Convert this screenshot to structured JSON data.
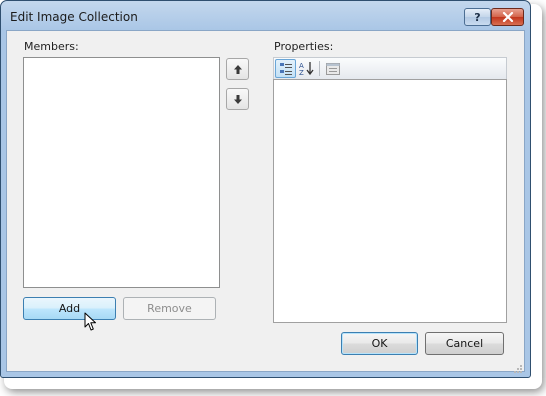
{
  "window": {
    "title": "Edit Image Collection",
    "help_label": "?",
    "close_icon": "close-icon"
  },
  "members": {
    "label": "Members:",
    "items": [],
    "move_up_icon": "arrow-up-icon",
    "move_down_icon": "arrow-down-icon",
    "add_label": "Add",
    "remove_label": "Remove"
  },
  "properties": {
    "label": "Properties:",
    "toolbar": {
      "categorized_icon": "categorized-view-icon",
      "alphabetical_icon": "alphabetical-sort-icon",
      "property_pages_icon": "property-pages-icon"
    }
  },
  "footer": {
    "ok_label": "OK",
    "cancel_label": "Cancel"
  },
  "colors": {
    "title_bar": "#a9c6e6",
    "close_button": "#c2361d",
    "hover_button": "#bee6fd",
    "dialog_background": "#f0f0f0"
  }
}
